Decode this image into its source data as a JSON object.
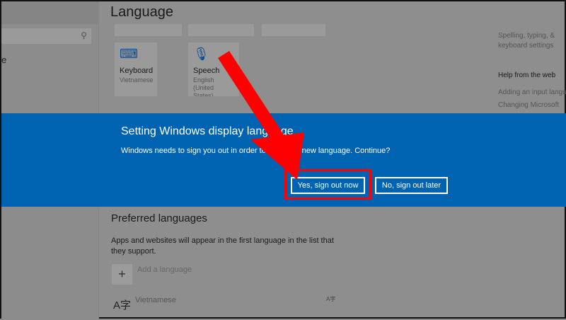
{
  "page": {
    "title": "Language"
  },
  "sidebar": {
    "partial_label": "e"
  },
  "tiles": [
    {
      "name": "Keyboard",
      "sub": "Vietnamese",
      "icon": "keyboard-icon"
    },
    {
      "name": "Speech",
      "sub": "English (United States)",
      "icon": "microphone-icon"
    }
  ],
  "related": {
    "link1": "Spelling, typing, & keyboard settings",
    "help_title": "Help from the web",
    "help_links": [
      "Adding an input language",
      "Changing Microsoft"
    ]
  },
  "dialog": {
    "title": "Setting Windows display language",
    "text": "Windows needs to sign you out in order to apply the new language. Continue?",
    "yes": "Yes, sign out now",
    "no": "No, sign out later",
    "color": "#0063b1"
  },
  "preferred": {
    "title": "Preferred languages",
    "text": "Apps and websites will appear in the first language in the list that they support.",
    "add_label": "Add a language",
    "languages": [
      {
        "name": "Vietnamese"
      }
    ]
  },
  "annotation": {
    "color": "#ff0000"
  }
}
